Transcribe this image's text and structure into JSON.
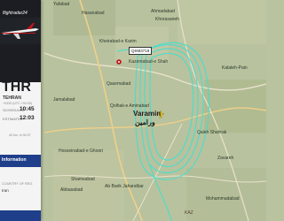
{
  "panel": {
    "logo": "flightradar24",
    "airport_code": "THR",
    "city": "TEHRAN",
    "timezone": "+0430 (UTC +04:30)",
    "departure": {
      "label": "SCHEDULED",
      "time": "10:45"
    },
    "arrival": {
      "label": "ESTIMATED",
      "time": "12:03"
    },
    "duration": "40 km, in 00:37",
    "info_section": "Information",
    "country_label": "COUNTRY OF REG.",
    "country_value": "Iran",
    "colors": {
      "header": "#1b1d22",
      "section": "#1f3f8a",
      "accent": "#c0161b"
    }
  },
  "map": {
    "flight_tag": "QSM3719",
    "places": {
      "yafabad": "Yafabad",
      "hasanabad": "Hasanabad",
      "ahmadabad": "Ahmadabad",
      "khorasaneh": "Khorasaneh",
      "kheirabad": "Kheirabad-e Karim",
      "kazemabad": "Kazemabad-e Shah",
      "kalateh": "Kalateh-Pain",
      "qasemabad": "Qasemabad",
      "qaleh": "Qaleh Shahrak",
      "qolhak": "Qolhak-e Aminabad",
      "jamalabad": "Jamalabad",
      "varamin": "Varamin",
      "varamin_fa": "ورامین",
      "hosseinabad": "Hosseinabad-e Ghoori",
      "zavareh": "Zavareh",
      "shamsabad": "Shamsabad",
      "abbasabad": "Abbasabad",
      "abbarik": "Ab Barik Jahandbar",
      "mohammadabad": "Mohammadabad",
      "kaz": "KAZ"
    }
  }
}
